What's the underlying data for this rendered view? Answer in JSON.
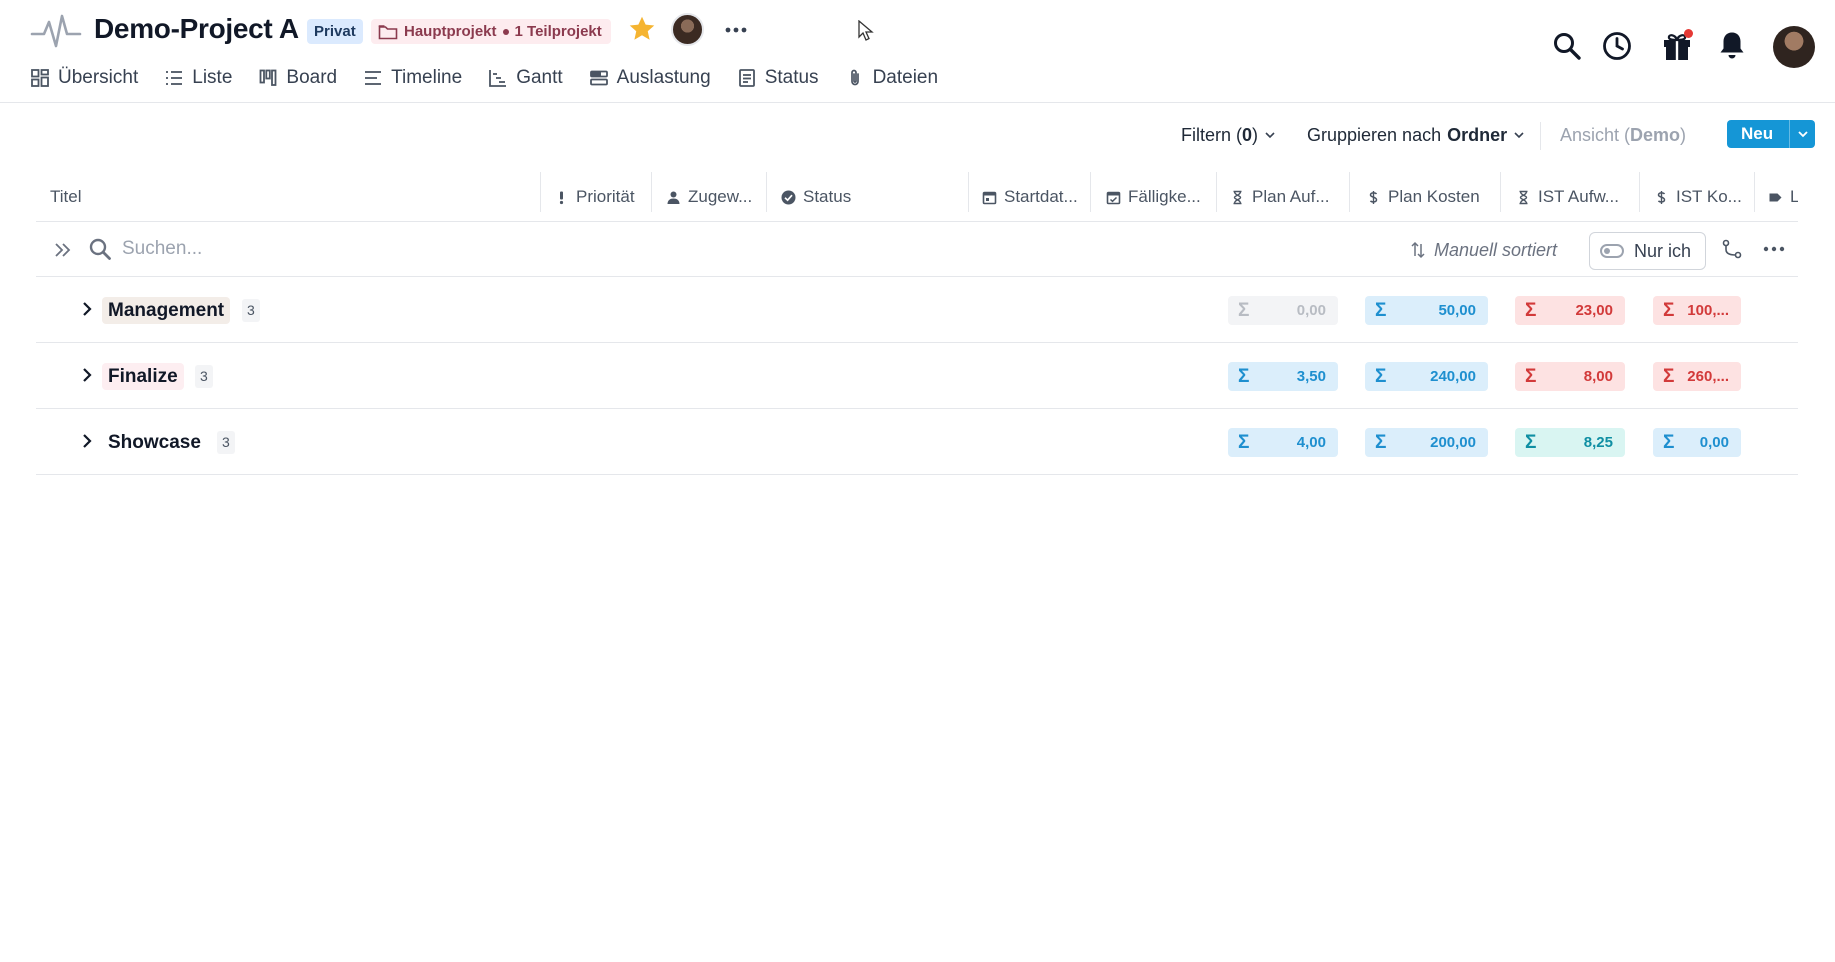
{
  "header": {
    "project_title": "Demo-Project A",
    "badge_private": "Privat",
    "badge_main_project": "Hauptprojekt",
    "badge_subprojects": "1 Teilprojekt"
  },
  "nav": {
    "tabs": [
      {
        "label": "Übersicht",
        "icon": "overview-icon"
      },
      {
        "label": "Liste",
        "icon": "list-icon"
      },
      {
        "label": "Board",
        "icon": "board-icon"
      },
      {
        "label": "Timeline",
        "icon": "timeline-icon"
      },
      {
        "label": "Gantt",
        "icon": "gantt-icon"
      },
      {
        "label": "Auslastung",
        "icon": "workload-icon"
      },
      {
        "label": "Status",
        "icon": "status-doc-icon"
      },
      {
        "label": "Dateien",
        "icon": "paperclip-icon"
      }
    ]
  },
  "toolbar": {
    "filter_label": "Filtern (",
    "filter_count": "0",
    "filter_close": ")",
    "group_label": "Gruppieren nach",
    "group_value": "Ordner",
    "view_label": "Ansicht (",
    "view_value": "Demo",
    "view_close": ")",
    "new_button": "Neu"
  },
  "columns": {
    "title": "Titel",
    "priority": "Priorität",
    "assignee": "Zugew...",
    "status": "Status",
    "start": "Startdat...",
    "due": "Fälligke...",
    "plan_effort": "Plan Auf...",
    "plan_cost": "Plan Kosten",
    "actual_effort": "IST Aufw...",
    "actual_cost": "IST Ko...",
    "labels": "L"
  },
  "search": {
    "placeholder": "Suchen...",
    "sort_label": "Manuell sortiert",
    "only_me": "Nur ich"
  },
  "groups": [
    {
      "name": "Management",
      "count": "3",
      "plan_effort": "0,00",
      "plan_cost": "50,00",
      "actual_effort": "23,00",
      "actual_cost": "100,..."
    },
    {
      "name": "Finalize",
      "count": "3",
      "plan_effort": "3,50",
      "plan_cost": "240,00",
      "actual_effort": "8,00",
      "actual_cost": "260,..."
    },
    {
      "name": "Showcase",
      "count": "3",
      "plan_effort": "4,00",
      "plan_cost": "200,00",
      "actual_effort": "8,25",
      "actual_cost": "0,00"
    }
  ],
  "sigma": "Σ",
  "colors": {
    "accent": "#1596d6",
    "sum_blue": "#1e8fcf",
    "sum_red": "#d23a3a",
    "sum_teal": "#0f8fa3",
    "star": "#f5b431",
    "notification_dot": "#e53935"
  }
}
